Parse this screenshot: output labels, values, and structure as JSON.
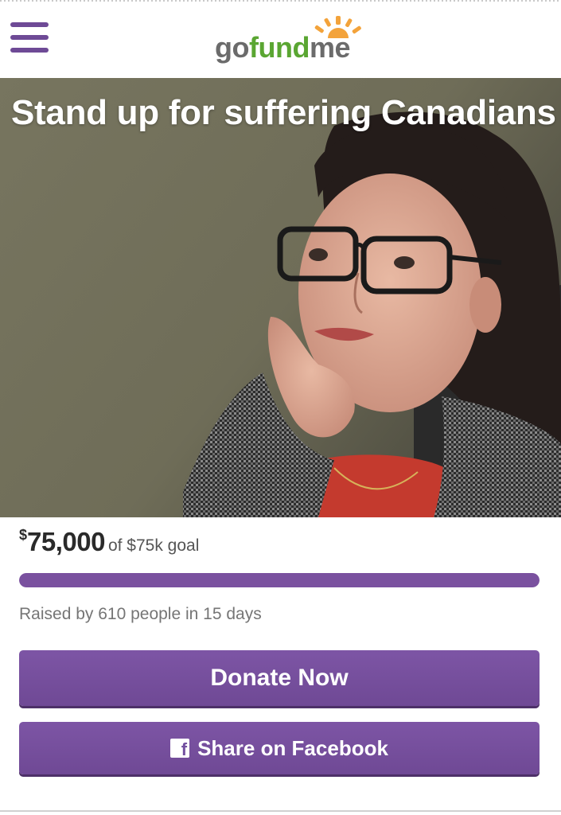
{
  "header": {
    "menu_icon": "hamburger-menu-icon",
    "logo": {
      "go": "go",
      "fund": "fund",
      "me": "me",
      "colors": {
        "gray": "#6b6b6b",
        "green": "#5aa632",
        "sun": "#f3a33b"
      }
    }
  },
  "campaign": {
    "title": "Stand up for suffering Canadians",
    "currency": "$",
    "amount": "75,000",
    "goal_text": "of $75k goal",
    "progress_percent": 100,
    "raised_by": "Raised by 610 people in 15 days"
  },
  "actions": {
    "donate_label": "Donate Now",
    "share_label": "Share on Facebook",
    "share_icon": "facebook-icon",
    "accent": "#734d9a"
  }
}
